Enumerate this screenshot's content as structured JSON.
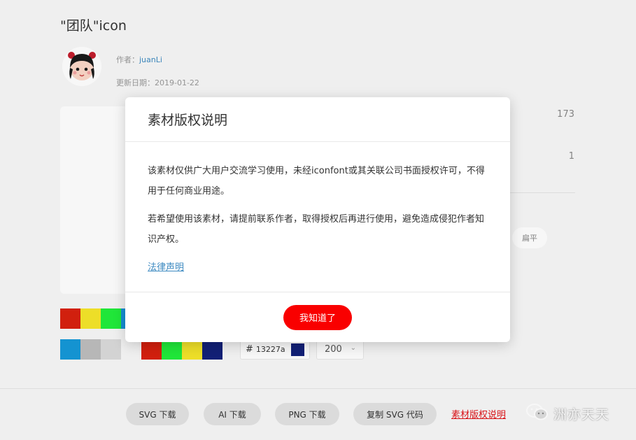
{
  "page": {
    "title": "\"团队\"icon",
    "author_label": "作者：",
    "author_name": "juanLi",
    "date_label": "更新日期：",
    "date_value": "2019-01-22",
    "stats": [
      "173",
      "1"
    ],
    "style_chip": "扁平"
  },
  "palette": {
    "row1": [
      "#d8220f",
      "#f5e62a",
      "#22ee3b",
      "#1791d8"
    ],
    "row2_left": [
      "#1598d8",
      "#bdbdbd",
      "#dadada"
    ],
    "row2_right": [
      "#d8220f",
      "#22ee3b",
      "#f5e62a",
      "#13227a"
    ]
  },
  "color_input": {
    "hash": "#",
    "value": "13227a",
    "color": "#13227a"
  },
  "size_select": {
    "value": "200",
    "chevron": "chevron-down-icon"
  },
  "footer": {
    "buttons": [
      "SVG 下载",
      "AI 下载",
      "PNG 下载",
      "复制 SVG 代码"
    ],
    "copyright_link": "素材版权说明",
    "watermark": "洲亦天天"
  },
  "modal": {
    "title": "素材版权说明",
    "paragraph_1": "该素材仅供广大用户交流学习使用，未经iconfont或其关联公司书面授权许可，不得用于任何商业用途。",
    "paragraph_2": "若希望使用该素材，请提前联系作者，取得授权后再进行使用，避免造成侵犯作者知识产权。",
    "legal_link": "法律声明",
    "ok_button": "我知道了"
  },
  "colors": {
    "accent_red": "#f90000",
    "link_blue": "#3d8ac1"
  }
}
